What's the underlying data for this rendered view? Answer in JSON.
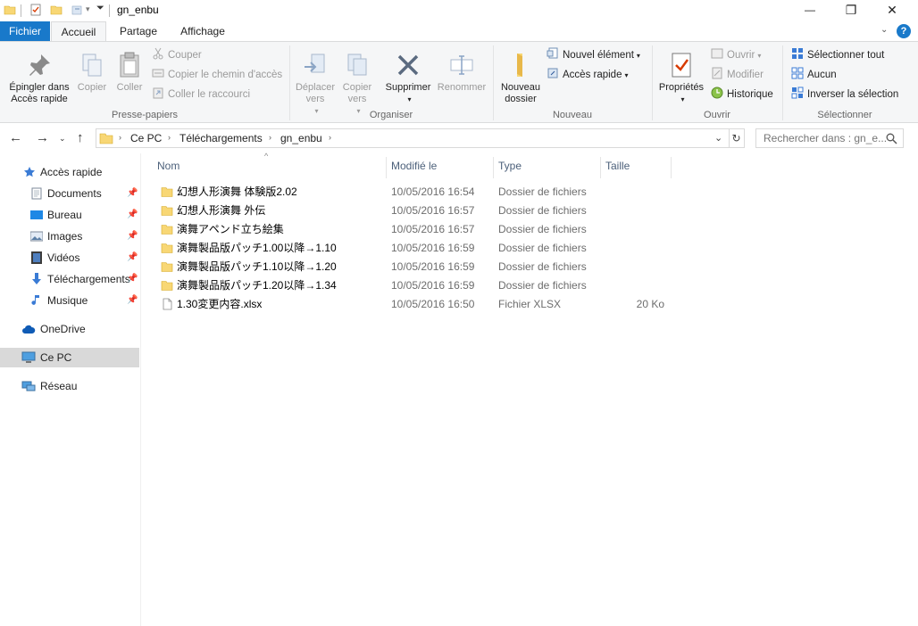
{
  "window": {
    "title": "gn_enbu",
    "minimize": "—",
    "restore": "❐",
    "close": "✕"
  },
  "tabs": {
    "file": "Fichier",
    "home": "Accueil",
    "share": "Partage",
    "view": "Affichage",
    "help": "?"
  },
  "ribbon": {
    "clipboard": {
      "label": "Presse-papiers",
      "pin": "Épingler dans Accès rapide",
      "copy": "Copier",
      "paste": "Coller",
      "cut": "Couper",
      "copy_path": "Copier le chemin d'accès",
      "paste_shortcut": "Coller le raccourci"
    },
    "organize": {
      "label": "Organiser",
      "move_to": "Déplacer vers",
      "copy_to": "Copier vers",
      "delete": "Supprimer",
      "rename": "Renommer"
    },
    "new": {
      "label": "Nouveau",
      "new_folder": "Nouveau dossier",
      "new_item": "Nouvel élément",
      "easy_access": "Accès rapide"
    },
    "open": {
      "label": "Ouvrir",
      "properties": "Propriétés",
      "open": "Ouvrir",
      "edit": "Modifier",
      "history": "Historique"
    },
    "select": {
      "label": "Sélectionner",
      "select_all": "Sélectionner tout",
      "select_none": "Aucun",
      "invert": "Inverser la sélection"
    }
  },
  "address": {
    "crumbs": [
      "Ce PC",
      "Téléchargements",
      "gn_enbu"
    ],
    "search_placeholder": "Rechercher dans : gn_e..."
  },
  "nav": {
    "quick_access": "Accès rapide",
    "documents": "Documents",
    "desktop": "Bureau",
    "pictures": "Images",
    "videos": "Vidéos",
    "downloads": "Téléchargements",
    "music": "Musique",
    "onedrive": "OneDrive",
    "this_pc": "Ce PC",
    "network": "Réseau"
  },
  "columns": {
    "name": "Nom",
    "modified": "Modifié le",
    "type": "Type",
    "size": "Taille"
  },
  "files": [
    {
      "name": "幻想人形演舞 体験版2.02",
      "modified": "10/05/2016 16:54",
      "type": "Dossier de fichiers",
      "size": "",
      "icon": "folder-icon"
    },
    {
      "name": "幻想人形演舞 外伝",
      "modified": "10/05/2016 16:57",
      "type": "Dossier de fichiers",
      "size": "",
      "icon": "folder-icon"
    },
    {
      "name": "演舞アペンド立ち絵集",
      "modified": "10/05/2016 16:57",
      "type": "Dossier de fichiers",
      "size": "",
      "icon": "folder-icon"
    },
    {
      "name": "演舞製品版パッチ1.00以降→1.10",
      "modified": "10/05/2016 16:59",
      "type": "Dossier de fichiers",
      "size": "",
      "icon": "folder-icon"
    },
    {
      "name": "演舞製品版パッチ1.10以降→1.20",
      "modified": "10/05/2016 16:59",
      "type": "Dossier de fichiers",
      "size": "",
      "icon": "folder-icon"
    },
    {
      "name": "演舞製品版パッチ1.20以降→1.34",
      "modified": "10/05/2016 16:59",
      "type": "Dossier de fichiers",
      "size": "",
      "icon": "folder-icon"
    },
    {
      "name": "1.30変更内容.xlsx",
      "modified": "10/05/2016 16:50",
      "type": "Fichier XLSX",
      "size": "20 Ko",
      "icon": "document-icon"
    }
  ],
  "colors": {
    "accent": "#1979ca",
    "folder": "#f8d775",
    "ribbon_bg": "#f5f6f7",
    "selected_nav": "#d9d9d9"
  }
}
